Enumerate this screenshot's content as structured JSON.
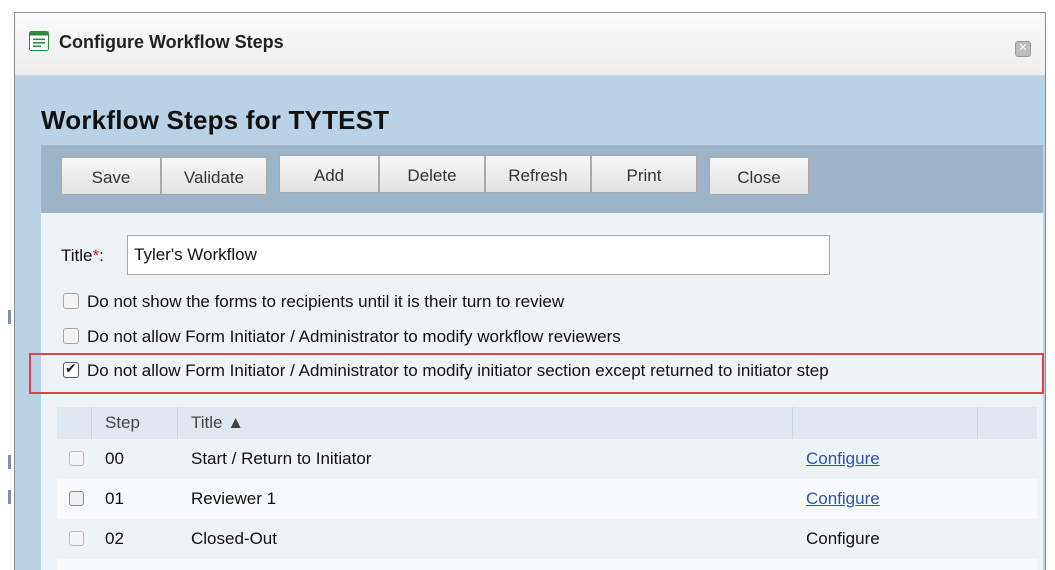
{
  "dialog": {
    "title": "Configure Workflow Steps",
    "close_glyph": "✕"
  },
  "page": {
    "heading": "Workflow Steps for TYTEST"
  },
  "toolbar": {
    "save": "Save",
    "validate": "Validate",
    "add": "Add",
    "delete": "Delete",
    "refresh": "Refresh",
    "print": "Print",
    "close": "Close"
  },
  "form": {
    "title_label": "Title",
    "required_marker": "*",
    "title_colon": ":",
    "title_value": "Tyler's Workflow",
    "options": [
      {
        "label": "Do not show the forms to recipients until it is their turn to review",
        "checked": false
      },
      {
        "label": "Do not allow Form Initiator / Administrator to modify workflow reviewers",
        "checked": false
      },
      {
        "label": "Do not allow Form Initiator / Administrator to modify initiator section except returned to initiator step",
        "checked": true
      }
    ]
  },
  "grid": {
    "headers": {
      "step": "Step",
      "title": "Title ▲"
    },
    "rows": [
      {
        "step": "00",
        "title": "Start / Return to Initiator",
        "action": "Configure",
        "action_link": true
      },
      {
        "step": "01",
        "title": "Reviewer 1",
        "action": "Configure",
        "action_link": true
      },
      {
        "step": "02",
        "title": "Closed-Out",
        "action": "Configure",
        "action_link": false
      }
    ]
  },
  "colors": {
    "dialog_bg": "#b9d2e6",
    "toolbar_bg": "#9db4c8",
    "highlight_border": "#e0414b",
    "link": "#2a57a8"
  }
}
